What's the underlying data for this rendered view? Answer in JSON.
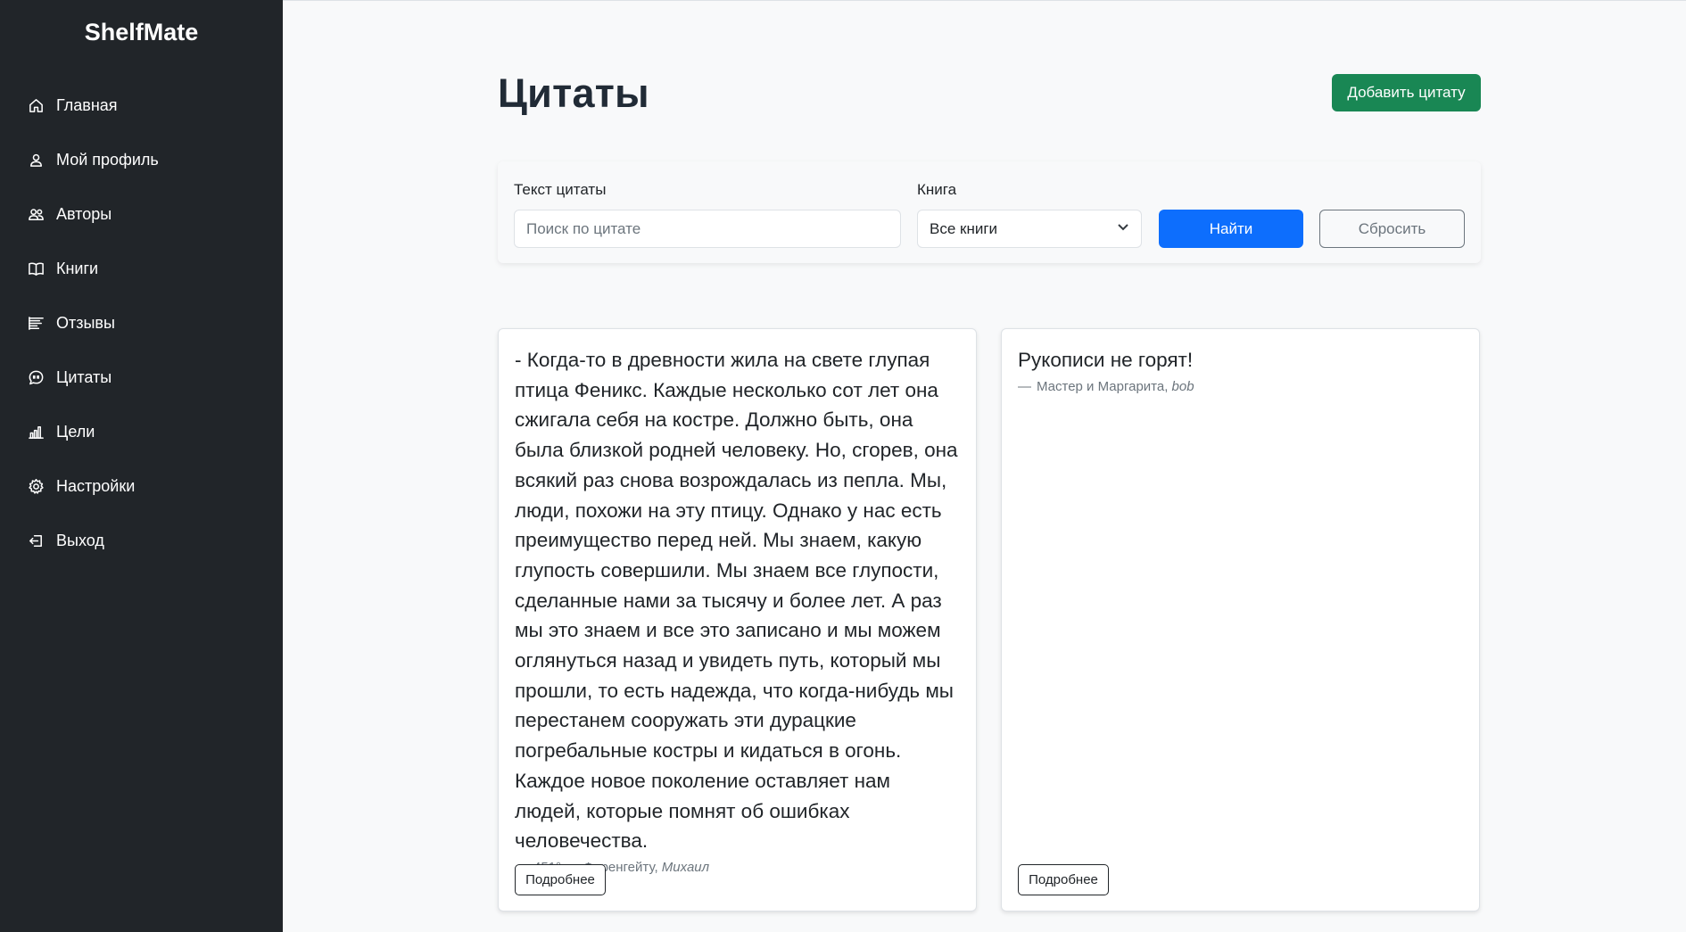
{
  "brand": "ShelfMate",
  "sidebar": {
    "items": [
      {
        "label": "Главная",
        "icon": "home-icon"
      },
      {
        "label": "Мой профиль",
        "icon": "user-icon"
      },
      {
        "label": "Авторы",
        "icon": "users-icon"
      },
      {
        "label": "Книги",
        "icon": "book-icon"
      },
      {
        "label": "Отзывы",
        "icon": "reviews-icon"
      },
      {
        "label": "Цитаты",
        "icon": "quote-chat-icon"
      },
      {
        "label": "Цели",
        "icon": "bar-chart-icon"
      },
      {
        "label": "Настройки",
        "icon": "gear-icon"
      },
      {
        "label": "Выход",
        "icon": "logout-icon"
      }
    ]
  },
  "page": {
    "title": "Цитаты",
    "add_button": "Добавить цитату"
  },
  "filter": {
    "text_label": "Текст цитаты",
    "text_placeholder": "Поиск по цитате",
    "text_value": "",
    "book_label": "Книга",
    "book_selected": "Все книги",
    "find_button": "Найти",
    "reset_button": "Сбросить"
  },
  "quotes": [
    {
      "text": "- Когда-то в древности жила на свете глупая птица Феникс. Каждые несколько сот лет она сжигала себя на костре. Должно быть, она была близкой родней человеку. Но, сгорев, она всякий раз снова возрождалась из пепла. Мы, люди, похожи на эту птицу. Однако у нас есть преимущество перед ней. Мы знаем, какую глупость совершили. Мы знаем все глупости, сделанные нами за тысячу и более лет. А раз мы это знаем и все это записано и мы можем оглянуться назад и увидеть путь, который мы прошли, то есть надежда, что когда-нибудь мы перестанем сооружать эти дурацкие погребальные костры и кидаться в огонь. Каждое новое поколение оставляет нам людей, которые помнят об ошибках человечества.",
      "dash": "—",
      "book": "451° по Фаренгейту,",
      "user": "Михаил",
      "more_button": "Подробнее"
    },
    {
      "text": "Рукописи не горят!",
      "dash": "—",
      "book": "Мастер и Маргарита,",
      "user": "bob",
      "more_button": "Подробнее"
    }
  ],
  "colors": {
    "sidebar_bg": "#212529",
    "add_button": "#198754",
    "find_button": "#0d6efd"
  }
}
